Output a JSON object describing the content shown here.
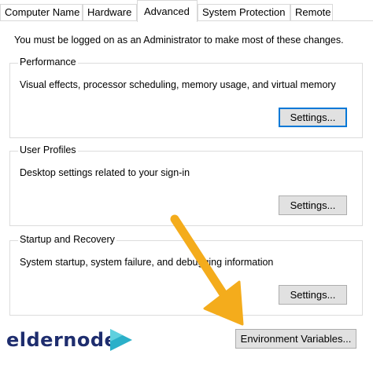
{
  "tabs": [
    {
      "label": "Computer Name",
      "active": false
    },
    {
      "label": "Hardware",
      "active": false
    },
    {
      "label": "Advanced",
      "active": true
    },
    {
      "label": "System Protection",
      "active": false
    },
    {
      "label": "Remote",
      "active": false
    }
  ],
  "intro_text": "You must be logged on as an Administrator to make most of these changes.",
  "groups": {
    "performance": {
      "title": "Performance",
      "description": "Visual effects, processor scheduling, memory usage, and virtual memory",
      "button_label": "Settings..."
    },
    "user_profiles": {
      "title": "User Profiles",
      "description": "Desktop settings related to your sign-in",
      "button_label": "Settings..."
    },
    "startup_recovery": {
      "title": "Startup and Recovery",
      "description": "System startup, system failure, and debugging information",
      "button_label": "Settings..."
    }
  },
  "environment_button_label": "Environment Variables...",
  "watermark": {
    "brand": "eldernode"
  },
  "colors": {
    "arrow": "#f4ac1c",
    "focus_border": "#0078d7",
    "button_face": "#e1e1e1",
    "brand_text": "#1e2d6e",
    "brand_accent": "#2bb0c9"
  },
  "icons": {
    "arrow": "pointer-arrow-icon",
    "logo": "eldernode-play-icon"
  }
}
